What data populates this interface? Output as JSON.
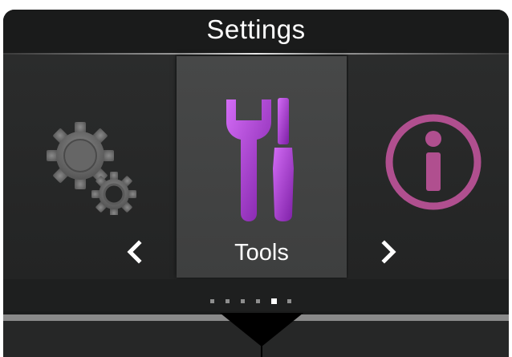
{
  "header": {
    "title": "Settings"
  },
  "carousel": {
    "items": [
      {
        "label": "",
        "icon": "gears-icon"
      },
      {
        "label": "Tools",
        "icon": "tools-icon"
      },
      {
        "label": "",
        "icon": "info-icon"
      }
    ],
    "selected_index": 1,
    "prev_arrow": "‹",
    "next_arrow": "›"
  },
  "pager": {
    "count": 6,
    "active_index": 4
  },
  "colors": {
    "accent": "#a53ad1",
    "info": "#b04f8f",
    "gear": "#6e6e6e"
  }
}
